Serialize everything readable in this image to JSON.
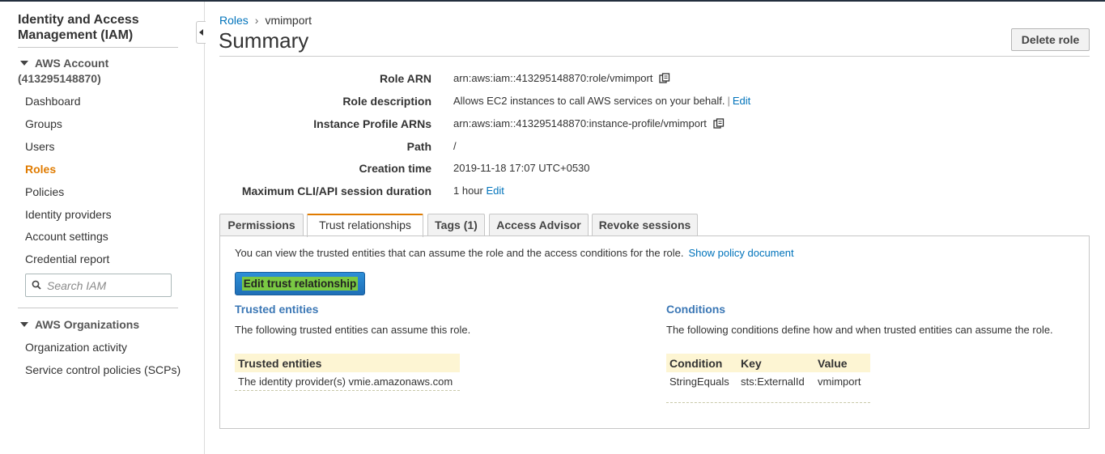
{
  "sidebar": {
    "title": "Identity and Access Management (IAM)",
    "account_group": "AWS Account",
    "account_id": "(413295148870)",
    "items": [
      {
        "label": "Dashboard"
      },
      {
        "label": "Groups"
      },
      {
        "label": "Users"
      },
      {
        "label": "Roles"
      },
      {
        "label": "Policies"
      },
      {
        "label": "Identity providers"
      },
      {
        "label": "Account settings"
      },
      {
        "label": "Credential report"
      }
    ],
    "active_item": "Roles",
    "search_placeholder": "Search IAM",
    "org_group": "AWS Organizations",
    "org_items": [
      {
        "label": "Organization activity"
      },
      {
        "label": "Service control policies (SCPs)"
      }
    ]
  },
  "breadcrumb": {
    "parent": "Roles",
    "separator": "›",
    "current": "vmimport"
  },
  "page": {
    "title": "Summary",
    "delete_button": "Delete role"
  },
  "summary": {
    "role_arn_label": "Role ARN",
    "role_arn": "arn:aws:iam::413295148870:role/vmimport",
    "description_label": "Role description",
    "description": "Allows EC2 instances to call AWS services on your behalf.",
    "description_sep": "|",
    "description_edit": "Edit",
    "instance_profile_label": "Instance Profile ARNs",
    "instance_profile": "arn:aws:iam::413295148870:instance-profile/vmimport",
    "path_label": "Path",
    "path": "/",
    "creation_label": "Creation time",
    "creation": "2019-11-18 17:07 UTC+0530",
    "max_session_label": "Maximum CLI/API session duration",
    "max_session": "1 hour",
    "max_session_edit": "Edit"
  },
  "tabs": [
    {
      "label": "Permissions"
    },
    {
      "label": "Trust relationships"
    },
    {
      "label": "Tags (1)"
    },
    {
      "label": "Access Advisor"
    },
    {
      "label": "Revoke sessions"
    }
  ],
  "active_tab": "Trust relationships",
  "trust": {
    "intro": "You can view the trusted entities that can assume the role and the access conditions for the role.",
    "show_policy_link": "Show policy document",
    "edit_button": "Edit trust relationship",
    "entities_heading": "Trusted entities",
    "entities_desc": "The following trusted entities can assume this role.",
    "entities_col": "Trusted entities",
    "entities_rows": [
      "The identity provider(s) vmie.amazonaws.com"
    ],
    "conditions_heading": "Conditions",
    "conditions_desc": "The following conditions define how and when trusted entities can assume the role.",
    "conditions_cols": [
      "Condition",
      "Key",
      "Value"
    ],
    "conditions_rows": [
      [
        "StringEquals",
        "sts:ExternalId",
        "vmimport"
      ]
    ]
  },
  "colors": {
    "accent": "#e07b00",
    "link": "#0073bb",
    "section_heading": "#3b77b5",
    "primary_button": "#1f6fb7",
    "table_header_bg": "#fdf5d3"
  }
}
